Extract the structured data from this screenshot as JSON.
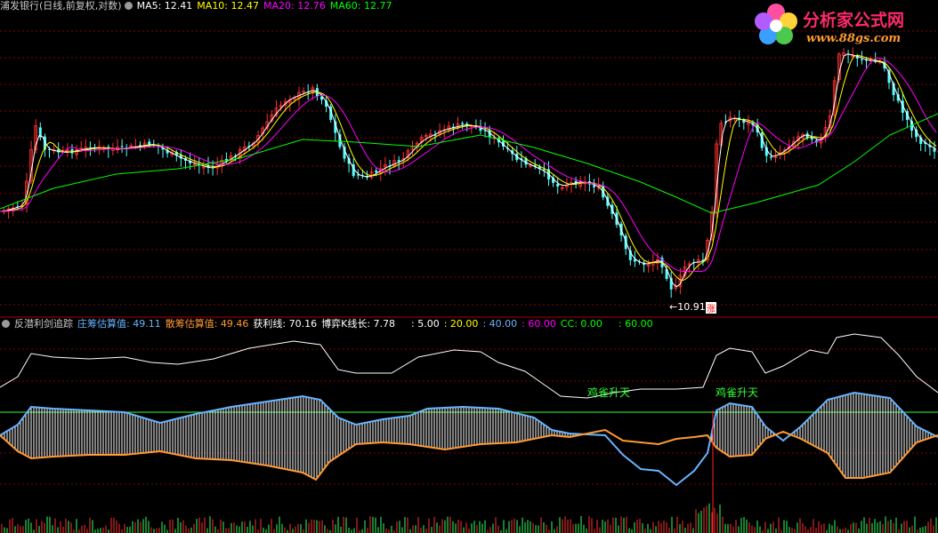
{
  "main_legend": {
    "stock_title": "浦发银行(日线,前复权,对数)",
    "ma5": "MA5: 12.41",
    "ma10": "MA10: 12.47",
    "ma20": "MA20: 12.76",
    "ma60": "MA60: 12.77"
  },
  "low_label": "←10.91",
  "badge": "涨",
  "indicator_legend": {
    "name": "反潜利剑追踪",
    "zhuang": "庄筹估算值: 49.11",
    "san": "散筹估算值: 49.46",
    "profit": "获利线: 70.16",
    "bozk": "博弈K线长: 7.78",
    "l5": ": 5.00",
    "l20": ": 20.00",
    "l40": ": 40.00",
    "l60": ": 60.00",
    "cc": "CC: 0.00",
    "l60b": ": 60.00"
  },
  "signals": [
    "鸡雀升天",
    "鸡雀升天"
  ],
  "logo": {
    "text": "分析家公式网",
    "url": "www.88gs.com"
  },
  "colors": {
    "ma5": "#ffffff",
    "ma10": "#ffff00",
    "ma20": "#ff00ff",
    "ma60": "#00ff00",
    "up": "#ff3030",
    "down": "#54ffff",
    "zhuang": "#66b4ff",
    "san": "#ff9933",
    "profit": "#ffffff",
    "signal": "#33ff33",
    "grid": "#8a0000"
  }
}
